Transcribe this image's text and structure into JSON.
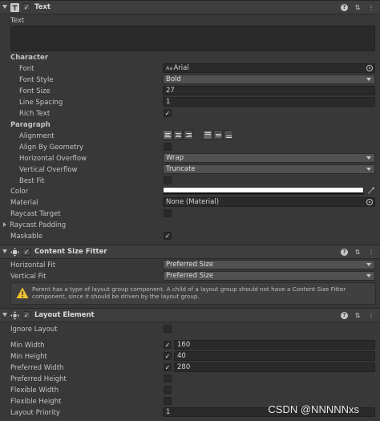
{
  "text_component": {
    "title": "Text",
    "text_label": "Text",
    "text_value": "",
    "character_header": "Character",
    "font_label": "Font",
    "font_value": "Arial",
    "font_icon_text": "Aa",
    "font_style_label": "Font Style",
    "font_style_value": "Bold",
    "font_size_label": "Font Size",
    "font_size_value": "27",
    "line_spacing_label": "Line Spacing",
    "line_spacing_value": "1",
    "rich_text_label": "Rich Text",
    "rich_text_checked": "✓",
    "paragraph_header": "Paragraph",
    "alignment_label": "Alignment",
    "align_by_geometry_label": "Align By Geometry",
    "horizontal_overflow_label": "Horizontal Overflow",
    "horizontal_overflow_value": "Wrap",
    "vertical_overflow_label": "Vertical Overflow",
    "vertical_overflow_value": "Truncate",
    "best_fit_label": "Best Fit",
    "color_label": "Color",
    "color_value": "#ffffff",
    "material_label": "Material",
    "material_value": "None (Material)",
    "raycast_target_label": "Raycast Target",
    "raycast_padding_label": "Raycast Padding",
    "maskable_label": "Maskable",
    "maskable_checked": "✓"
  },
  "content_size_fitter": {
    "title": "Content Size Fitter",
    "horizontal_fit_label": "Horizontal Fit",
    "horizontal_fit_value": "Preferred Size",
    "vertical_fit_label": "Vertical Fit",
    "vertical_fit_value": "Preferred Size",
    "warning_message": "Parent has a type of layout group component. A child of a layout group should not have a Content Size Fitter component, since it should be driven by the layout group."
  },
  "layout_element": {
    "title": "Layout Element",
    "ignore_layout_label": "Ignore Layout",
    "min_width_label": "Min Width",
    "min_width_value": "160",
    "min_height_label": "Min Height",
    "min_height_value": "40",
    "preferred_width_label": "Preferred Width",
    "preferred_width_value": "280",
    "preferred_height_label": "Preferred Height",
    "flexible_width_label": "Flexible Width",
    "flexible_height_label": "Flexible Height",
    "layout_priority_label": "Layout Priority",
    "layout_priority_value": "1"
  },
  "header_buttons": {
    "help": "?",
    "presets": "⇅",
    "menu": "⋮"
  },
  "checkmark": "✓",
  "watermark": "CSDN @NNNNNxs"
}
